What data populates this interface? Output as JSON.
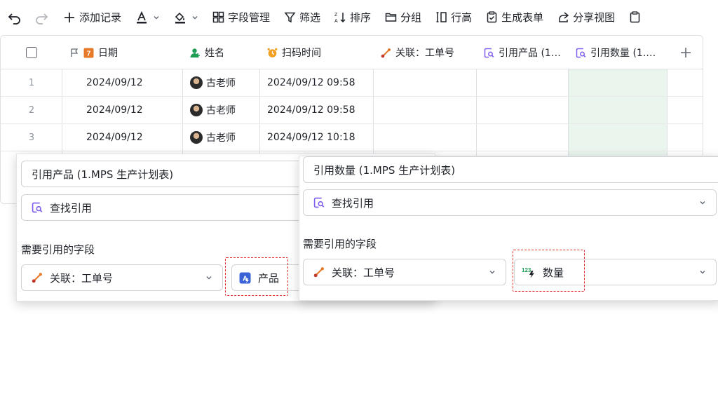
{
  "toolbar": {
    "undo_icon": "undo-icon",
    "redo_icon": "redo-icon",
    "add_record": "添加记录",
    "text_color_icon": "text-color-icon",
    "fill_color_icon": "fill-color-icon",
    "field_manage": "字段管理",
    "filter": "筛选",
    "sort": "排序",
    "group": "分组",
    "row_height": "行高",
    "create_form": "生成表单",
    "share_view": "分享视图"
  },
  "table": {
    "headers": {
      "date": "日期",
      "name": "姓名",
      "scan_time": "扫码时间",
      "link": "关联：工单号",
      "ref_product": "引用产品 (1…",
      "ref_qty": "引用数量 (1.…"
    },
    "rows": [
      {
        "num": "1",
        "date": "2024/09/12",
        "name": "古老师",
        "scan": "2024/09/12 09:58"
      },
      {
        "num": "2",
        "date": "2024/09/12",
        "name": "古老师",
        "scan": "2024/09/12 09:58"
      },
      {
        "num": "3",
        "date": "2024/09/12",
        "name": "古老师",
        "scan": "2024/09/12 10:18"
      }
    ]
  },
  "popup_left": {
    "title": "引用产品 (1.MPS 生产计划表)",
    "type": "查找引用",
    "section_label": "需要引用的字段",
    "link_field": "关联：工单号",
    "target_field": "产品"
  },
  "popup_right": {
    "title": "引用数量 (1.MPS 生产计划表)",
    "type": "查找引用",
    "section_label": "需要引用的字段",
    "link_field": "关联：工单号",
    "target_field": "数量"
  },
  "colors": {
    "accent_purple": "#7f5cf0",
    "link_orange": "#e57a2a",
    "highlight_green": "#eaf5ee",
    "annotation_red": "#e02b2b"
  }
}
